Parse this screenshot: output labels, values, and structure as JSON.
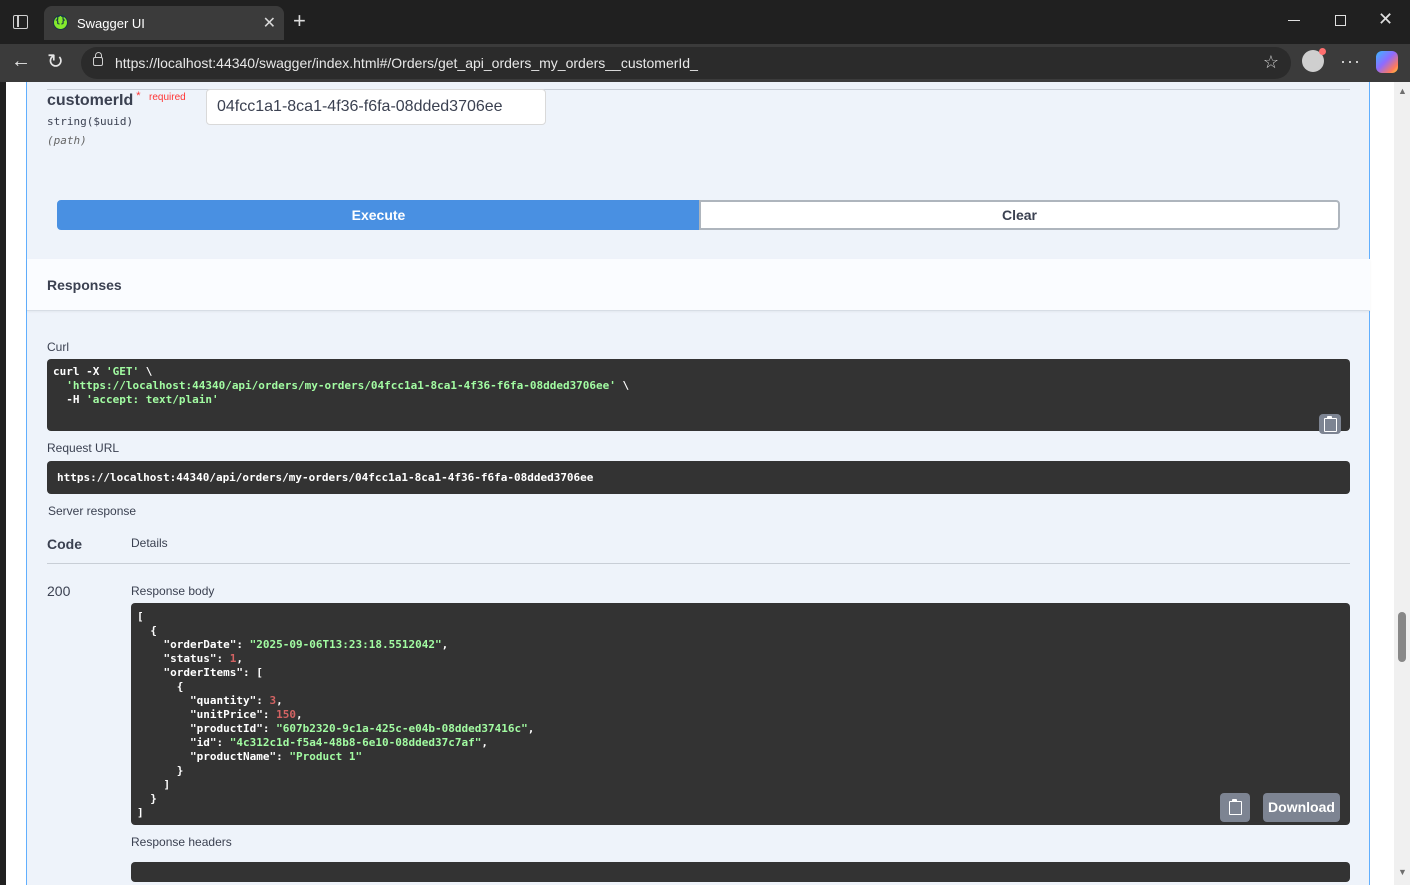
{
  "browser": {
    "tab_title": "Swagger UI",
    "url": "https://localhost:44340/swagger/index.html#/Orders/get_api_orders_my_orders__customerId_"
  },
  "parameter": {
    "name": "customerId",
    "required_star": "*",
    "required_label": "required",
    "type": "string($uuid)",
    "in": "(path)",
    "value": "04fcc1a1-8ca1-4f36-f6fa-08dded3706ee"
  },
  "buttons": {
    "execute": "Execute",
    "clear": "Clear",
    "download": "Download"
  },
  "responses": {
    "title": "Responses",
    "curl_label": "Curl",
    "curl": {
      "line1": "curl -X ",
      "line1_method": "'GET'",
      "line1_end": " \\",
      "line2": "'https://localhost:44340/api/orders/my-orders/04fcc1a1-8ca1-4f36-f6fa-08dded3706ee'",
      "line2_end": " \\",
      "line3": "  -H ",
      "line3_header": "'accept: text/plain'"
    },
    "request_url_label": "Request URL",
    "request_url": "https://localhost:44340/api/orders/my-orders/04fcc1a1-8ca1-4f36-f6fa-08dded3706ee",
    "server_response_label": "Server response",
    "code_header": "Code",
    "details_header": "Details",
    "status_code": "200",
    "response_body_label": "Response body",
    "response_headers_label": "Response headers",
    "body": {
      "orderDate": "\"2025-09-06T13:23:18.5512042\"",
      "status": "1",
      "quantity": "3",
      "unitPrice": "150",
      "productId": "\"607b2320-9c1a-425c-e04b-08dded37416c\"",
      "id": "\"4c312c1d-f5a4-48b8-6e10-08dded37c7af\"",
      "productName": "\"Product 1\""
    }
  }
}
